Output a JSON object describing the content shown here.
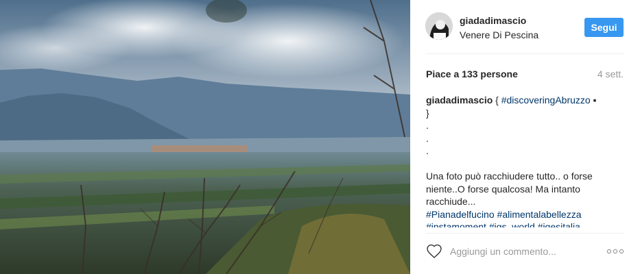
{
  "post": {
    "username": "giadadimascio",
    "location": "Venere Di Pescina",
    "follow_label": "Segui",
    "likes": "Piace a 133 persone",
    "time": "4 sett.",
    "caption": {
      "author": "giadadimascio",
      "line1_pre": " { ",
      "line1_tag": "#discoveringAbruzzo",
      "line1_post": " ▪",
      "line2": "}",
      "dot1": ".",
      "dot2": ".",
      "dot3": ".",
      "text_line1": "Una foto può racchiudere tutto.. o forse",
      "text_line2": "niente..O forse qualcosa! Ma intanto",
      "text_line3": "racchiude...",
      "tags_line1": [
        "#Pianadelfucino",
        "#alimentalabellezza"
      ],
      "tags_line2": [
        "#instamoment",
        "#igs_world",
        "#igesitalia"
      ]
    },
    "comment_placeholder": "Aggiungi un commento...",
    "icons": {
      "like": "heart-outline-icon",
      "more": "more-options-icon"
    }
  },
  "colors": {
    "accent": "#3897f0",
    "hashtag": "#003569",
    "muted": "#999999"
  }
}
